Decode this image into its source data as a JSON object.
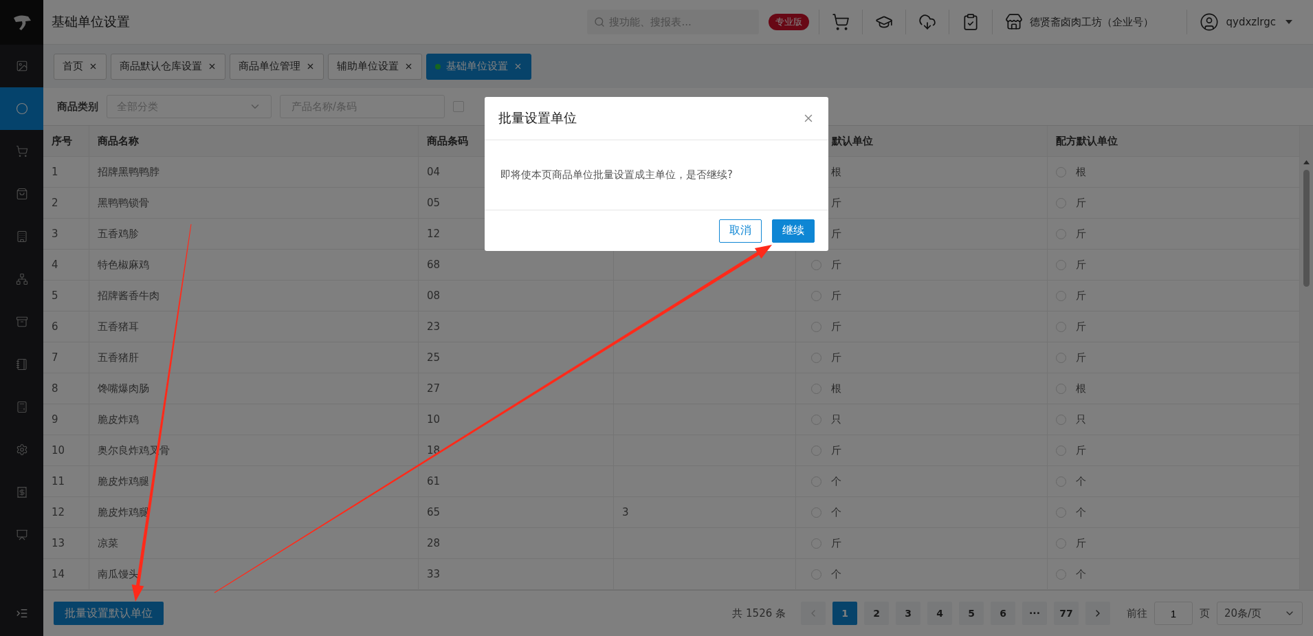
{
  "topbar": {
    "title": "基础单位设置",
    "search": {
      "placeholder": "搜功能、搜报表..."
    },
    "badge": "专业版",
    "store": "德贤斋卤肉工坊（企业号）",
    "user": "qydxzlrgc"
  },
  "sidebar": {
    "items": [
      {
        "selected": false
      },
      {
        "selected": true
      },
      {
        "selected": false
      },
      {
        "selected": false
      },
      {
        "selected": false
      },
      {
        "selected": false
      },
      {
        "selected": false
      },
      {
        "selected": false
      },
      {
        "selected": false
      },
      {
        "selected": false
      },
      {
        "selected": false
      },
      {
        "selected": false
      }
    ]
  },
  "tabs": [
    {
      "label": "首页",
      "selected": false
    },
    {
      "label": "商品默认仓库设置",
      "selected": false
    },
    {
      "label": "商品单位管理",
      "selected": false
    },
    {
      "label": "辅助单位设置",
      "selected": false
    },
    {
      "label": "基础单位设置",
      "selected": true
    }
  ],
  "filter": {
    "label": "商品类别",
    "category": {
      "placeholder": "全部分类"
    },
    "search": {
      "placeholder": "产品名称/条码"
    },
    "checkbox": {
      "checked": false
    }
  },
  "table": {
    "columns": [
      "序号",
      "商品名称",
      "商品条码",
      "默认单位",
      "配方默认单位"
    ],
    "rows": [
      {
        "no": "1",
        "name": "招牌黑鸭鸭脖",
        "code": "04",
        "unit": "根",
        "recipe_unit": "根",
        "recipe_checked": false
      },
      {
        "no": "2",
        "name": "黑鸭鸭锁骨",
        "code": "05",
        "unit": "斤",
        "recipe_unit": "斤",
        "recipe_checked": false
      },
      {
        "no": "3",
        "name": "五香鸡胗",
        "code": "12",
        "unit": "斤",
        "recipe_unit": "斤",
        "recipe_checked": false
      },
      {
        "no": "4",
        "name": "特色椒麻鸡",
        "code": "68",
        "unit": "斤",
        "unit_checked": false,
        "recipe_unit": "斤",
        "recipe_checked": false
      },
      {
        "no": "5",
        "name": "招牌酱香牛肉",
        "code": "08",
        "unit": "斤",
        "unit_checked": false,
        "recipe_unit": "斤",
        "recipe_checked": false
      },
      {
        "no": "6",
        "name": "五香猪耳",
        "code": "23",
        "unit": "斤",
        "unit_checked": false,
        "recipe_unit": "斤",
        "recipe_checked": false
      },
      {
        "no": "7",
        "name": "五香猪肝",
        "code": "25",
        "unit": "斤",
        "unit_checked": false,
        "recipe_unit": "斤",
        "recipe_checked": false
      },
      {
        "no": "8",
        "name": "馋嘴爆肉肠",
        "code": "27",
        "unit": "根",
        "unit_checked": false,
        "recipe_unit": "根",
        "recipe_checked": false
      },
      {
        "no": "9",
        "name": "脆皮炸鸡",
        "code": "10",
        "unit": "只",
        "unit_checked": false,
        "recipe_unit": "只",
        "recipe_checked": false
      },
      {
        "no": "10",
        "name": "奥尔良炸鸡叉骨",
        "code": "18",
        "unit": "斤",
        "unit_checked": false,
        "recipe_unit": "斤",
        "recipe_checked": false
      },
      {
        "no": "11",
        "name": "脆皮炸鸡腿",
        "code": "61",
        "unit": "个",
        "unit_checked": false,
        "recipe_unit": "个",
        "recipe_checked": false
      },
      {
        "no": "12",
        "name": "脆皮炸鸡腿",
        "code": "65",
        "column_4": "3",
        "unit": "个",
        "unit_checked": false,
        "recipe_unit": "个",
        "recipe_checked": false
      },
      {
        "no": "13",
        "name": "凉菜",
        "code": "28",
        "unit": "斤",
        "unit_checked": false,
        "recipe_unit": "斤",
        "recipe_checked": false
      },
      {
        "no": "14",
        "name": "南瓜馒头",
        "code": "33",
        "unit": "个",
        "unit_checked": false,
        "recipe_unit": "个",
        "recipe_checked": false
      }
    ]
  },
  "footer": {
    "batch_button": "批量设置默认单位",
    "total": "共 1526 条",
    "pages": [
      {
        "label": "1",
        "selected": true
      },
      {
        "label": "2",
        "selected": false
      },
      {
        "label": "3",
        "selected": false
      },
      {
        "label": "4",
        "selected": false
      },
      {
        "label": "5",
        "selected": false
      },
      {
        "label": "6",
        "selected": false
      },
      {
        "label": "···",
        "selected": false
      },
      {
        "label": "77",
        "selected": false
      }
    ],
    "goto_label": "前往",
    "goto_value": "1",
    "page_unit": "页",
    "page_size": "20条/页"
  },
  "dialog": {
    "title": "批量设置单位",
    "message": "即将使本页商品单位批量设置成主单位，是否继续?",
    "buttons": [
      "取消",
      "继续"
    ]
  }
}
